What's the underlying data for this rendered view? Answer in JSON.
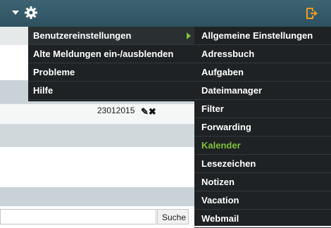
{
  "colors": {
    "topbar": "#2f5563",
    "menu_bg": "#1f2224",
    "accent_green": "#7ec23a",
    "logout_orange": "#f39c1f"
  },
  "header": {
    "icons": [
      "caret-down-icon",
      "gear-icon",
      "logout-icon"
    ]
  },
  "menu": {
    "items": [
      {
        "label": "Benutzereinstellungen",
        "has_submenu": true
      },
      {
        "label": "Alte Meldungen ein-/ausblenden"
      },
      {
        "label": "Probleme"
      },
      {
        "label": "Hilfe"
      }
    ]
  },
  "submenu": {
    "items": [
      {
        "label": "Allgemeine Einstellungen"
      },
      {
        "label": "Adressbuch"
      },
      {
        "label": "Aufgaben"
      },
      {
        "label": "Dateimanager"
      },
      {
        "label": "Filter"
      },
      {
        "label": "Forwarding"
      },
      {
        "label": "Kalender",
        "highlighted": true
      },
      {
        "label": "Lesezeichen"
      },
      {
        "label": "Notizen"
      },
      {
        "label": "Vacation"
      },
      {
        "label": "Webmail"
      }
    ]
  },
  "background": {
    "date_value": "23012015",
    "search_button": "Suche"
  }
}
